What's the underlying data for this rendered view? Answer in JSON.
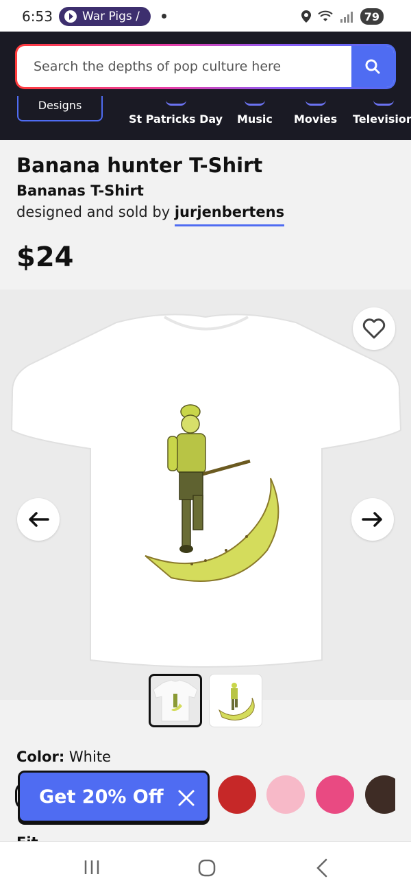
{
  "status_bar": {
    "time": "6:53",
    "media_label": "War Pigs /",
    "battery": "79"
  },
  "header": {
    "search": {
      "placeholder": "Search the depths of pop culture here"
    },
    "designs_label": "Designs",
    "categories": [
      "St Patricks Day",
      "Music",
      "Movies",
      "Television"
    ]
  },
  "product": {
    "title": "Banana hunter T-Shirt",
    "subtitle": "Bananas T-Shirt",
    "designed_by_prefix": "designed and sold by",
    "designer": "jurjenbertens",
    "price": "$24"
  },
  "options": {
    "color_label": "Color:",
    "color_value": "White",
    "swatches": [
      "#c62828",
      "#f7b9c8",
      "#e94a82",
      "#3e2c25"
    ],
    "fit_label": "Fit"
  },
  "promo": {
    "label": "Get 20% Off"
  },
  "colors": {
    "accent": "#4f6cf2",
    "header_bg": "#1a1a24",
    "media_pill": "#3d2f6e"
  },
  "icons": [
    "play-icon",
    "location-icon",
    "wifi-icon",
    "signal-icon",
    "search-icon",
    "heart-icon",
    "arrow-left-icon",
    "arrow-right-icon",
    "close-icon",
    "recent-apps-icon",
    "home-icon",
    "back-icon"
  ]
}
